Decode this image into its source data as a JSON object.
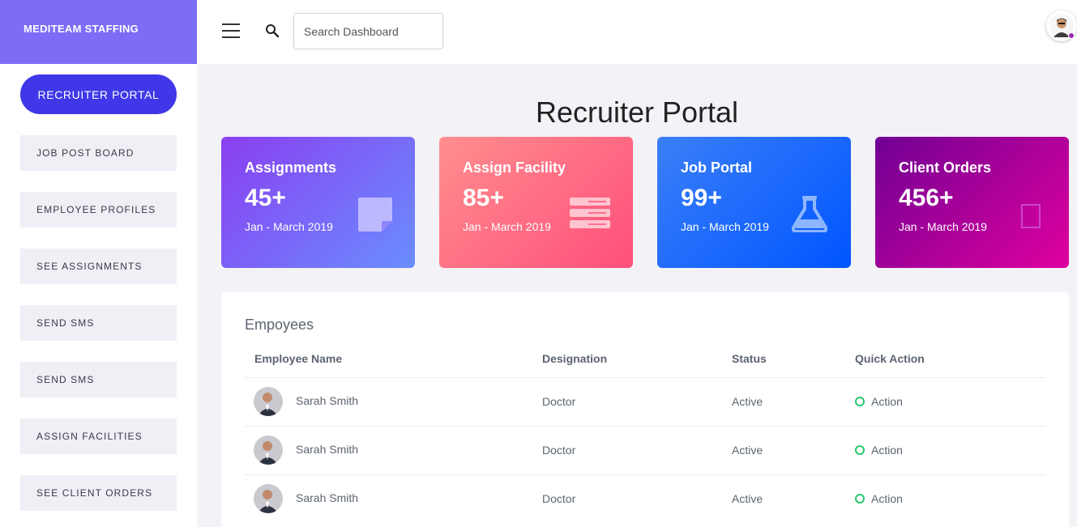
{
  "brand": "MEDITEAM STAFFING",
  "sidebar": {
    "portal_button": "RECRUITER PORTAL",
    "items": [
      "JOB POST BOARD",
      "EMPLOYEE PROFILES",
      "SEE ASSIGNMENTS",
      "SEND SMS",
      "SEND SMS",
      "ASSIGN FACILITIES",
      "SEE CLIENT ORDERS"
    ]
  },
  "header": {
    "search_placeholder": "Search Dashboard",
    "icons": [
      "menu-icon",
      "search-icon",
      "user-avatar-icon"
    ]
  },
  "main": {
    "title": "Recruiter Portal",
    "cards": [
      {
        "title": "Assignments",
        "value": "45+",
        "range": "Jan - March 2019",
        "icon": "sticky-note-icon",
        "colors": [
          "#8a3ff1",
          "#6a8dff"
        ]
      },
      {
        "title": "Assign Facility",
        "value": "85+",
        "range": "Jan - March 2019",
        "icon": "server-icon",
        "colors": [
          "#ff8e8e",
          "#ff4f7b"
        ]
      },
      {
        "title": "Job Portal",
        "value": "99+",
        "range": "Jan - March 2019",
        "icon": "flask-icon",
        "colors": [
          "#3b7ff8",
          "#0055ff"
        ]
      },
      {
        "title": "Client Orders",
        "value": "456+",
        "range": "Jan - March 2019",
        "icon": "square-outline-icon",
        "colors": [
          "#700093",
          "#e0009f"
        ]
      }
    ],
    "table": {
      "title": "Empoyees",
      "headers": [
        "Employee Name",
        "Designation",
        "Status",
        "Quick Action"
      ],
      "rows": [
        {
          "name": "Sarah Smith",
          "designation": "Doctor",
          "status": "Active",
          "action": "Action"
        },
        {
          "name": "Sarah Smith",
          "designation": "Doctor",
          "status": "Active",
          "action": "Action"
        },
        {
          "name": "Sarah Smith",
          "designation": "Doctor",
          "status": "Active",
          "action": "Action"
        }
      ]
    }
  },
  "colors": {
    "brand_bg": "#7c6cf6",
    "primary_button": "#3f37e8",
    "status_ring": "#28c76f"
  }
}
